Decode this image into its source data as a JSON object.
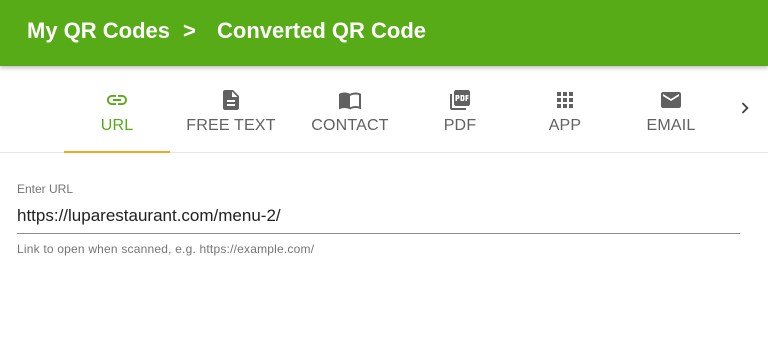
{
  "header": {
    "breadcrumb_root": "My QR Codes",
    "breadcrumb_separator": ">",
    "page_title": "Converted QR Code"
  },
  "tabs": [
    {
      "label": "URL",
      "icon": "link-icon",
      "active": true
    },
    {
      "label": "FREE TEXT",
      "icon": "document-icon",
      "active": false
    },
    {
      "label": "CONTACT",
      "icon": "book-icon",
      "active": false
    },
    {
      "label": "PDF",
      "icon": "pdf-icon",
      "active": false
    },
    {
      "label": "APP",
      "icon": "apps-grid-icon",
      "active": false
    },
    {
      "label": "EMAIL",
      "icon": "email-icon",
      "active": false
    }
  ],
  "tabs_next_icon": "chevron-right-icon",
  "url_field": {
    "label": "Enter URL",
    "value": "https://luparestaurant.com/menu-2/",
    "hint": "Link to open when scanned, e.g. https://example.com/"
  },
  "colors": {
    "header_bg": "#56ab17",
    "active_tab": "#56ab17",
    "tab_indicator": "#f5a623",
    "inactive_tab": "#616161"
  }
}
